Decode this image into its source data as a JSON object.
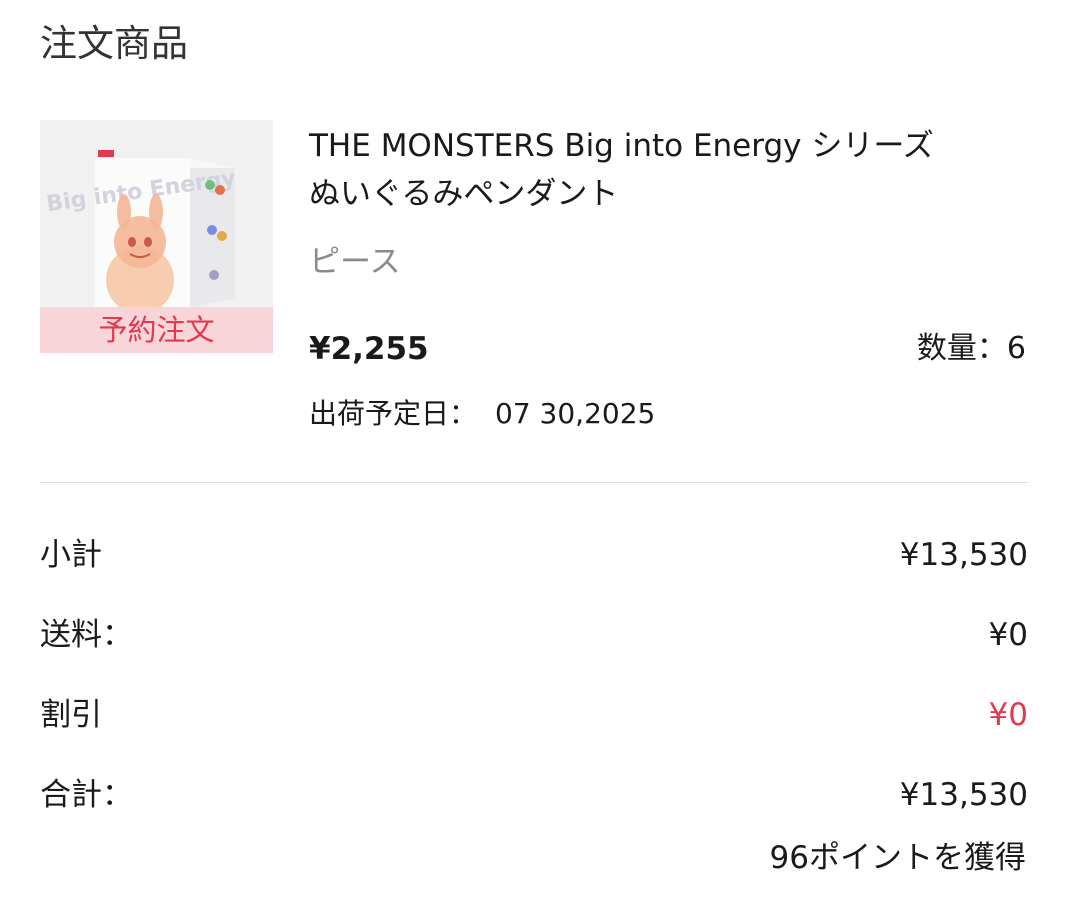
{
  "section_title": "注文商品",
  "product": {
    "badge": "予約注文",
    "name_line1": "THE MONSTERS Big into Energy シリーズ",
    "name_line2": "ぬいぐるみペンダント",
    "variant": "ピース",
    "price": "¥2,255",
    "quantity_label": "数量：6",
    "ship_date_label": "出荷予定日：",
    "ship_date_value": "07 30,2025",
    "image_box_text": "Big into Energy"
  },
  "summary": {
    "subtotal_label": "小計",
    "subtotal_value": "¥13,530",
    "shipping_label": "送料：",
    "shipping_value": "¥0",
    "discount_label": "割引",
    "discount_value": "¥0",
    "total_label": "合計：",
    "total_value": "¥13,530",
    "points_text": "96ポイントを獲得"
  },
  "colors": {
    "accent_red": "#e23a4c",
    "badge_bg": "#f7d2d6",
    "muted_text": "#8a8a8a",
    "divider": "#dddddd"
  }
}
